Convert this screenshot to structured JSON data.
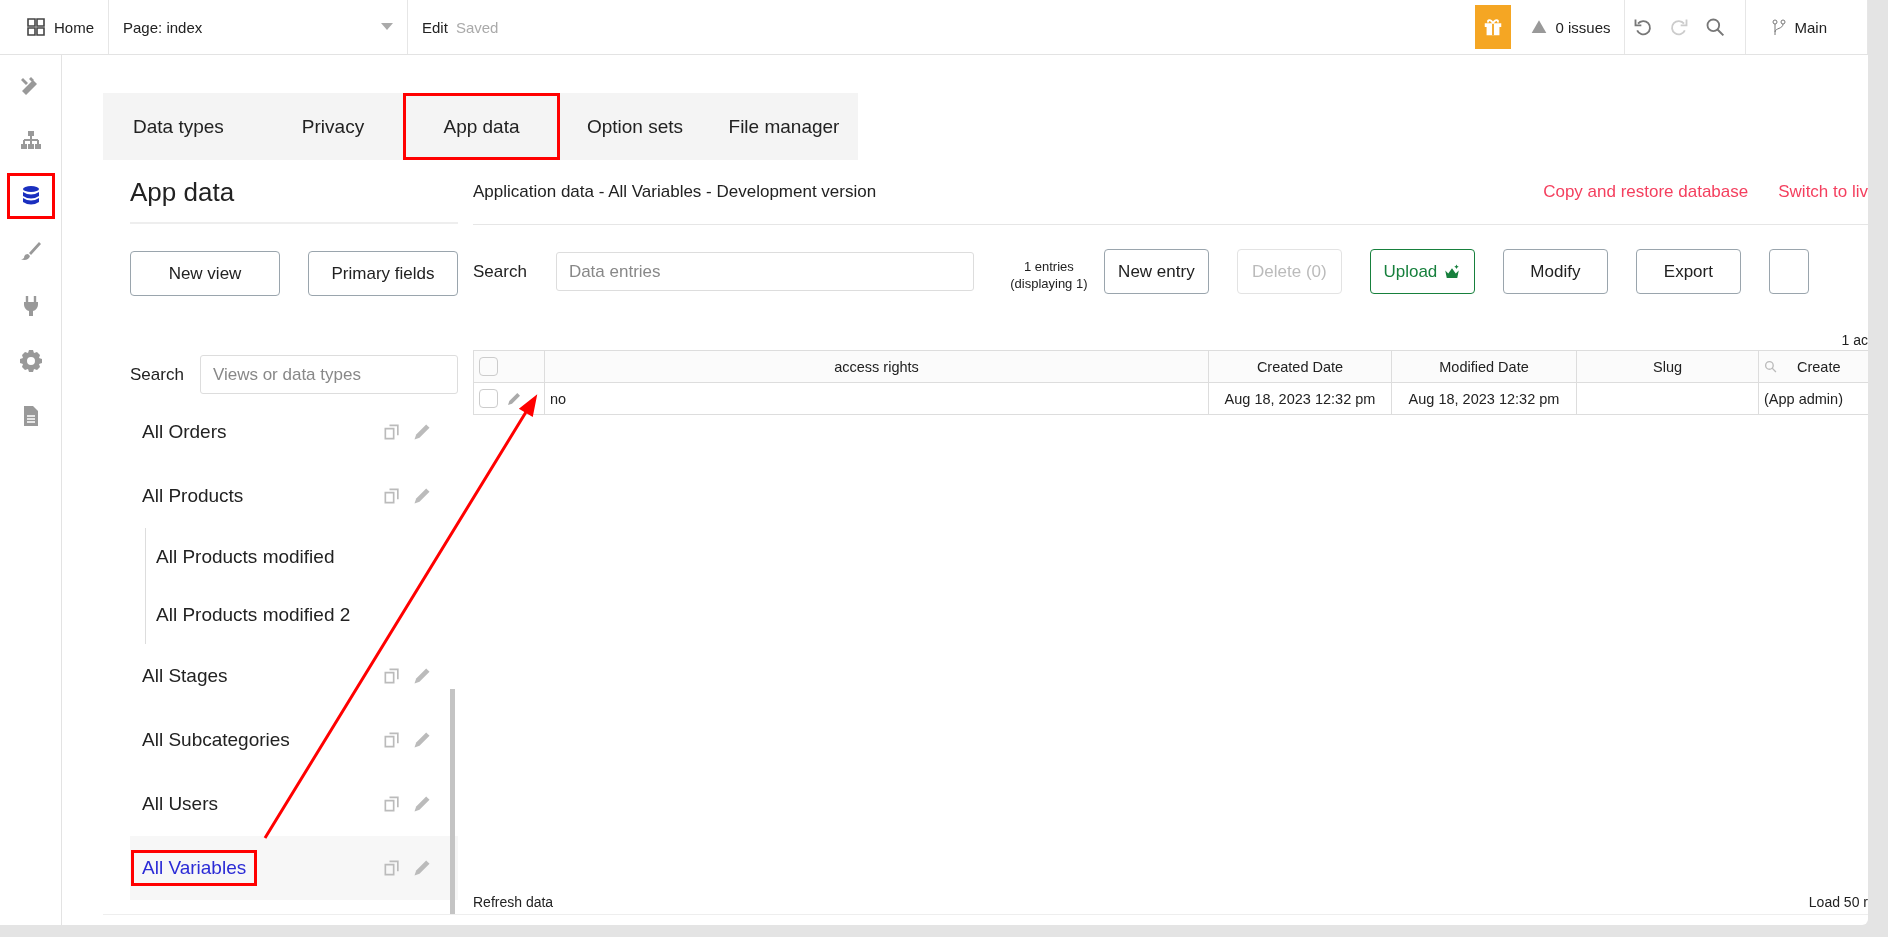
{
  "topbar": {
    "home": "Home",
    "page_select": "Page: index",
    "edit": "Edit",
    "saved": "Saved",
    "issues": "0 issues",
    "branch": "Main"
  },
  "rail": [
    {
      "selected": false,
      "highlighted": false
    },
    {
      "selected": false,
      "highlighted": false
    },
    {
      "selected": true,
      "highlighted": true
    },
    {
      "selected": false,
      "highlighted": false
    },
    {
      "selected": false,
      "highlighted": false
    },
    {
      "selected": false,
      "highlighted": false
    },
    {
      "selected": false,
      "highlighted": false
    }
  ],
  "tabs": [
    {
      "label": "Data types",
      "highlighted": false
    },
    {
      "label": "Privacy",
      "highlighted": false
    },
    {
      "label": "App data",
      "highlighted": true
    },
    {
      "label": "Option sets",
      "highlighted": false
    },
    {
      "label": "File manager",
      "highlighted": false
    }
  ],
  "left_panel": {
    "title": "App data",
    "buttons": [
      "New view",
      "Primary fields"
    ],
    "search_label": "Search",
    "search_placeholder": "Views or data types",
    "views": [
      {
        "label": "All Orders",
        "selected": false,
        "highlighted": false
      },
      {
        "label": "All Products",
        "selected": false,
        "highlighted": false,
        "children": [
          {
            "label": "All Products modified",
            "selected": false,
            "highlighted": false
          },
          {
            "label": "All Products modified 2",
            "selected": false,
            "highlighted": false
          }
        ]
      },
      {
        "label": "All Stages",
        "selected": false,
        "highlighted": false
      },
      {
        "label": "All Subcategories",
        "selected": false,
        "highlighted": false
      },
      {
        "label": "All Users",
        "selected": false,
        "highlighted": false
      },
      {
        "label": "All Variables",
        "selected": true,
        "highlighted": true
      }
    ]
  },
  "main": {
    "title": "Application data - All Variables - Development version",
    "links": [
      "Copy and restore database",
      "Switch to liv"
    ],
    "search_label": "Search",
    "search_placeholder": "Data entries",
    "entries_count": "1 entries (displaying 1)",
    "buttons": [
      {
        "label": "New entry",
        "kind": "plain"
      },
      {
        "label": "Delete (0)",
        "kind": "disabled"
      },
      {
        "label": "Upload",
        "kind": "upload"
      },
      {
        "label": "Modify",
        "kind": "plain"
      },
      {
        "label": "Export",
        "kind": "plain"
      },
      {
        "kind": "edge"
      }
    ],
    "table_note": "1 ac",
    "table": {
      "all_checked": false,
      "columns": [
        {
          "kind": "checkbox"
        },
        {
          "label": "access rights",
          "kind": "text"
        },
        {
          "label": "Created Date",
          "kind": "text"
        },
        {
          "label": "Modified Date",
          "kind": "text"
        },
        {
          "label": "Slug",
          "kind": "text"
        },
        {
          "label": "Create",
          "kind": "search"
        }
      ],
      "rows": [
        {
          "checked": false,
          "cells": [
            null,
            "no",
            "Aug 18, 2023 12:32 pm",
            "Aug 18, 2023 12:32 pm",
            null,
            "(App admin)"
          ]
        }
      ]
    },
    "footer": {
      "refresh": "Refresh data",
      "load": "Load 50 r"
    }
  }
}
